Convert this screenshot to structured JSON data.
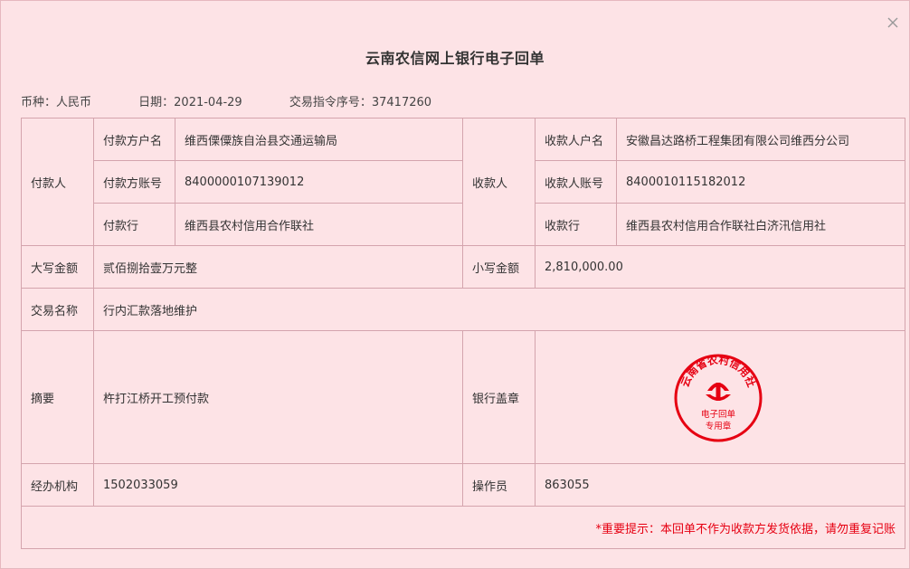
{
  "window": {
    "title": "云南农信网上银行电子回单"
  },
  "meta": {
    "currency": "币种：人民币",
    "date": "日期：2021-04-29",
    "serial": "交易指令序号：37417260"
  },
  "payer": {
    "label": "付款人",
    "name_label": "付款方户名",
    "name_value": "维西傈僳族自治县交通运输局",
    "account_label": "付款方账号",
    "account_value": "8400000107139012",
    "bank_label": "付款行",
    "bank_value": "维西县农村信用合作联社"
  },
  "payee": {
    "label": "收款人",
    "name_label": "收款人户名",
    "name_value": "安徽昌达路桥工程集团有限公司维西分公司",
    "account_label": "收款人账号",
    "account_value": "8400010115182012",
    "bank_label": "收款行",
    "bank_value": "维西县农村信用合作联社白济汛信用社"
  },
  "amount": {
    "upper_label": "大写金额",
    "upper_value": "贰佰捌拾壹万元整",
    "lower_label": "小写金额",
    "lower_value": "2,810,000.00"
  },
  "transaction": {
    "name_label": "交易名称",
    "name_value": "行内汇款落地维护"
  },
  "summary": {
    "label": "摘要",
    "value": "杵打江桥开工预付款",
    "seal_label": "银行盖章"
  },
  "stamp": {
    "top_text": "云南省农村信用社",
    "mid_text": "电子回单",
    "bottom_text": "专用章",
    "color": "#e60012"
  },
  "agency": {
    "label": "经办机构",
    "value": "1502033059",
    "operator_label": "操作员",
    "operator_value": "863055"
  },
  "footer": {
    "note": "*重要提示：本回单不作为收款方发货依据，请勿重复记账"
  },
  "icons": {
    "close": "close-icon"
  }
}
